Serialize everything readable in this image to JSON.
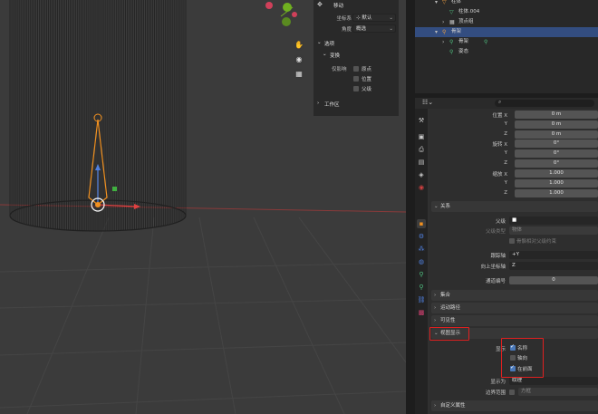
{
  "tool_panel": {
    "title": "移动",
    "orientation_label": "坐标系",
    "orientation_value": "默认",
    "pivot_label": "角度",
    "pivot_value": "概选",
    "options_section": "选项",
    "transform_section": "变换",
    "affect_label": "仅影响",
    "affect_origin": "原点",
    "affect_location": "位置",
    "affect_parent": "父级",
    "workspace_section": "工作区"
  },
  "outliner": {
    "rows": [
      {
        "label": "柱体",
        "indent": 1
      },
      {
        "label": "柱体.004",
        "indent": 2
      },
      {
        "label": "顶点组",
        "indent": 2
      },
      {
        "label": "骨架",
        "indent": 1,
        "selected": true
      },
      {
        "label": "骨架",
        "indent": 2
      },
      {
        "label": "姿态",
        "indent": 2
      }
    ]
  },
  "props": {
    "search_placeholder": "",
    "location_label": "位置 X",
    "location_values": [
      "0 m",
      "0 m",
      "0 m"
    ],
    "axis_y": "Y",
    "axis_z": "Z",
    "axis_x": "X",
    "rotation_label": "旋转 X",
    "rotation_values": [
      "0°",
      "0°",
      "0°"
    ],
    "scale_label": "缩放 X",
    "scale_values": [
      "1.000",
      "1.000",
      "1.000"
    ],
    "relations_section": "关系",
    "parent_label": "父级",
    "parent_type_label": "父级类型",
    "parent_type_value": "物体",
    "follow_label": "骨骼相对父级约束",
    "track_axis_label": "跟踪轴",
    "track_axis_value": "+Y",
    "up_axis_label": "向上坐标轴",
    "up_axis_value": "Z",
    "pass_index_label": "通道编号",
    "pass_index_value": "0",
    "collections_section": "集合",
    "motion_paths_section": "运动路径",
    "visibility_section": "可见性",
    "viewport_display_section": "视图显示",
    "show_label": "显示",
    "show_name": "名称",
    "show_axes": "轴向",
    "show_in_front": "在前面",
    "display_as_label": "显示为",
    "display_as_value": "纹理",
    "bounds_label": "边界范围",
    "bounds_value": "方框",
    "custom_props_section": "自定义属性"
  },
  "colors": {
    "accent_orange": "#f09020",
    "selected_row": "#334d80",
    "highlight_red": "#e02020",
    "checkbox_blue": "#4a78b8"
  }
}
